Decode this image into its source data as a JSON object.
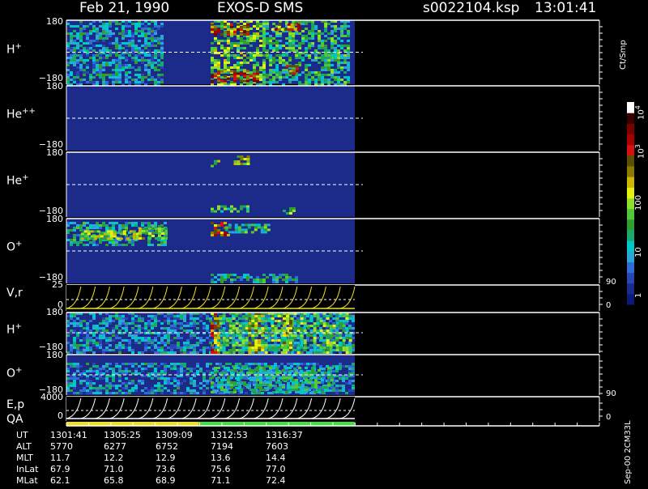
{
  "header": {
    "date": "Feb 21, 1990",
    "instrument": "EXOS-D SMS",
    "file": "s0022104.ksp",
    "time": "13:01:41"
  },
  "colors": {
    "bg_black": "#000000",
    "panel_blue": "#1c2a8a",
    "cbar": [
      "#0a1a78",
      "#1c2a8a",
      "#2748b0",
      "#2e6cd8",
      "#29a8d8",
      "#00c8c8",
      "#19a96a",
      "#2f9e2f",
      "#51c83a",
      "#8fe02c",
      "#e6f00a",
      "#cdb800",
      "#8a7a00",
      "#5a5000",
      "#d81010",
      "#a80000",
      "#7a0000",
      "#3a0000",
      "#ffffff"
    ],
    "yellow": "#f0e020",
    "green": "#40e040"
  },
  "chart_data": {
    "type": "heatmap",
    "panels": [
      {
        "id": "h-plus-1",
        "species": "H",
        "charge": "+",
        "ymax": "180",
        "ymin": "−180",
        "patches": [
          {
            "t0": 0.0,
            "t1": 0.33,
            "y0": 0.0,
            "y1": 1.0,
            "level": 0.25
          },
          {
            "t0": 0.5,
            "t1": 0.68,
            "y0": 0.0,
            "y1": 1.0,
            "level": 0.45
          },
          {
            "t0": 0.68,
            "t1": 0.98,
            "y0": 0.0,
            "y1": 1.0,
            "level": 0.35
          },
          {
            "t0": 0.5,
            "t1": 0.63,
            "y0": 0.05,
            "y1": 0.22,
            "level": 0.75
          },
          {
            "t0": 0.5,
            "t1": 0.66,
            "y0": 0.78,
            "y1": 0.95,
            "level": 0.75
          },
          {
            "t0": 0.71,
            "t1": 0.8,
            "y0": 0.05,
            "y1": 0.15,
            "level": 0.7
          },
          {
            "t0": 0.75,
            "t1": 0.8,
            "y0": 0.7,
            "y1": 0.82,
            "level": 0.7
          }
        ]
      },
      {
        "id": "he-plus-plus",
        "species": "He",
        "charge": "++",
        "ymax": "180",
        "ymin": "−180",
        "patches": []
      },
      {
        "id": "he-plus",
        "species": "He",
        "charge": "+",
        "ymax": "180",
        "ymin": "−180",
        "patches": [
          {
            "t0": 0.5,
            "t1": 0.53,
            "y0": 0.12,
            "y1": 0.22,
            "level": 0.45
          },
          {
            "t0": 0.58,
            "t1": 0.63,
            "y0": 0.05,
            "y1": 0.2,
            "level": 0.55
          },
          {
            "t0": 0.5,
            "t1": 0.63,
            "y0": 0.82,
            "y1": 0.92,
            "level": 0.4
          },
          {
            "t0": 0.75,
            "t1": 0.79,
            "y0": 0.85,
            "y1": 0.95,
            "level": 0.4
          }
        ]
      },
      {
        "id": "o-plus-1",
        "species": "O",
        "charge": "+",
        "ymax": "180",
        "ymin": "−180",
        "patches": [
          {
            "t0": 0.0,
            "t1": 0.34,
            "y0": 0.05,
            "y1": 0.4,
            "level": 0.3
          },
          {
            "t0": 0.05,
            "t1": 0.25,
            "y0": 0.18,
            "y1": 0.3,
            "level": 0.5
          },
          {
            "t0": 0.25,
            "t1": 0.34,
            "y0": 0.1,
            "y1": 0.3,
            "level": 0.5
          },
          {
            "t0": 0.5,
            "t1": 0.56,
            "y0": 0.05,
            "y1": 0.25,
            "level": 0.7
          },
          {
            "t0": 0.55,
            "t1": 0.7,
            "y0": 0.08,
            "y1": 0.2,
            "level": 0.35
          },
          {
            "t0": 0.5,
            "t1": 0.8,
            "y0": 0.85,
            "y1": 0.98,
            "level": 0.3
          }
        ]
      },
      {
        "id": "h-plus-2",
        "species": "H",
        "charge": "+",
        "ymax": "180",
        "ymin": "−180",
        "patches": [
          {
            "t0": 0.0,
            "t1": 1.0,
            "y0": 0.0,
            "y1": 1.0,
            "level": 0.22
          },
          {
            "t0": 0.5,
            "t1": 0.53,
            "y0": 0.0,
            "y1": 1.0,
            "level": 0.7
          },
          {
            "t0": 0.53,
            "t1": 0.98,
            "y0": 0.0,
            "y1": 1.0,
            "level": 0.4
          },
          {
            "t0": 0.63,
            "t1": 0.68,
            "y0": 0.0,
            "y1": 1.0,
            "level": 0.6
          },
          {
            "t0": 0.75,
            "t1": 0.78,
            "y0": 0.0,
            "y1": 1.0,
            "level": 0.6
          }
        ]
      },
      {
        "id": "o-plus-2",
        "species": "O",
        "charge": "+",
        "ymax": "180",
        "ymin": "−180",
        "patches": [
          {
            "t0": 0.0,
            "t1": 1.0,
            "y0": 0.2,
            "y1": 0.95,
            "level": 0.22
          },
          {
            "t0": 0.5,
            "t1": 0.92,
            "y0": 0.3,
            "y1": 0.95,
            "level": 0.32
          }
        ]
      }
    ],
    "line_panels": [
      {
        "id": "v-r",
        "label": "V,r",
        "ymax": "25",
        "ymin": "0",
        "right_top": "90",
        "right_bottom": "0"
      },
      {
        "id": "e-p",
        "label": "E,p",
        "label2": "QA",
        "ymax": "4000",
        "ymin": "0",
        "right_top": "90",
        "right_bottom": "0"
      }
    ],
    "colorbar": {
      "unit": "Ct/Smp",
      "ticks": [
        "1",
        "10",
        "100",
        "10",
        "10"
      ],
      "exps": [
        "",
        "",
        "",
        "3",
        "4"
      ]
    },
    "ephemeris": {
      "rows": [
        {
          "label": "UT",
          "values": [
            "1301:41",
            "1305:25",
            "1309:09",
            "1312:53",
            "1316:37"
          ]
        },
        {
          "label": "ALT",
          "values": [
            "5770",
            "6277",
            "6752",
            "7194",
            "7603"
          ]
        },
        {
          "label": "MLT",
          "values": [
            "11.7",
            "12.2",
            "12.9",
            "13.6",
            "14.4"
          ]
        },
        {
          "label": "InLat",
          "values": [
            "67.9",
            "71.0",
            "73.6",
            "75.6",
            "77.0"
          ]
        },
        {
          "label": "MLat",
          "values": [
            "62.1",
            "65.8",
            "68.9",
            "71.1",
            "72.4"
          ]
        }
      ]
    },
    "qa_bar": [
      {
        "t0": 0.0,
        "t1": 0.46,
        "color": "#f0e020"
      },
      {
        "t0": 0.46,
        "t1": 1.0,
        "color": "#40e040"
      }
    ],
    "footer": "Sep-00 2CM33L"
  }
}
